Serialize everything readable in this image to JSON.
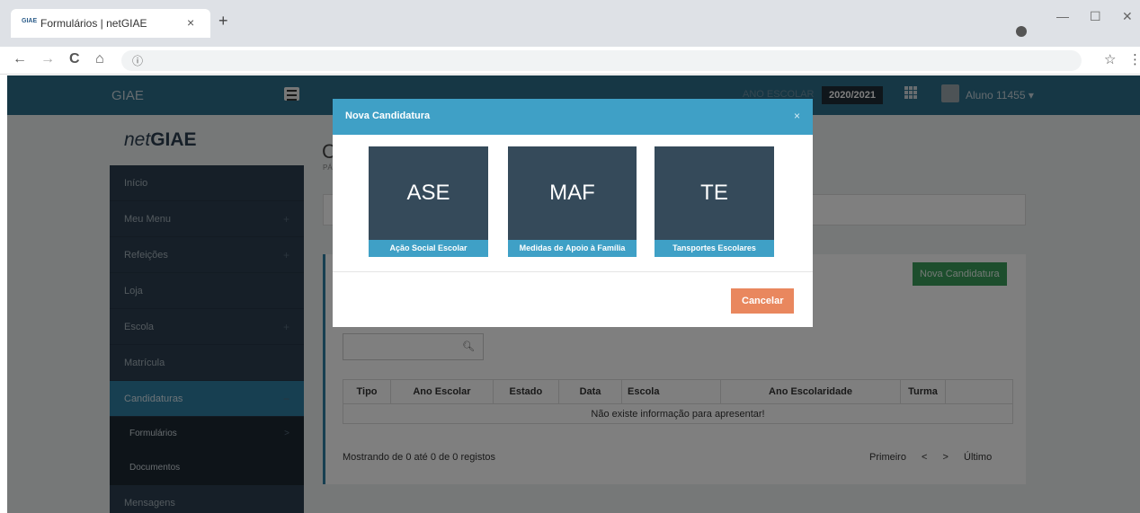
{
  "browser": {
    "tab_title": "Formulários | netGIAE",
    "favicon_text": "GIAE",
    "tab_close": "×",
    "new_tab": "+",
    "minimize": "—",
    "maximize": "☐",
    "close": "✕",
    "back": "←",
    "forward": "→",
    "reload": "C",
    "home": "⌂",
    "info": "ⓘ",
    "star": "☆",
    "menu": "⋮"
  },
  "topbar": {
    "brand": "GIAE",
    "school_year_label": "ANO ESCOLAR",
    "school_year": "2020/2021",
    "user": "Aluno 11455 ▾"
  },
  "sidebar": {
    "logo_prefix": "net",
    "logo_main": "GIAE",
    "items": [
      {
        "label": "Início",
        "suffix": ""
      },
      {
        "label": "Meu Menu",
        "suffix": "+"
      },
      {
        "label": "Refeições",
        "suffix": "+"
      },
      {
        "label": "Loja",
        "suffix": ""
      },
      {
        "label": "Escola",
        "suffix": "+"
      },
      {
        "label": "Matrícula",
        "suffix": ""
      },
      {
        "label": "Candidaturas",
        "suffix": "−"
      }
    ],
    "subitems": [
      {
        "label": "Formulários",
        "suffix": ">"
      },
      {
        "label": "Documentos",
        "suffix": ""
      }
    ],
    "after": [
      {
        "label": "Mensagens"
      }
    ]
  },
  "content": {
    "title": "C",
    "subtitle": "PÁ",
    "nova_button": "Nova Candidatura",
    "table_headers": [
      "Tipo",
      "Ano Escolar",
      "Estado",
      "Data",
      "Escola",
      "Ano Escolaridade",
      "Turma",
      ""
    ],
    "empty_message": "Não existe informação para apresentar!",
    "records_text": "Mostrando de 0 até 0 de 0 registos",
    "pager": [
      "Primeiro",
      "<",
      ">",
      "Último"
    ]
  },
  "modal": {
    "title": "Nova Candidatura",
    "close": "×",
    "tiles": [
      {
        "abbr": "ASE",
        "label": "Ação Social Escolar"
      },
      {
        "abbr": "MAF",
        "label": "Medidas de Apoio à Família"
      },
      {
        "abbr": "TE",
        "label": "Tansportes Escolares"
      }
    ],
    "cancel": "Cancelar"
  },
  "colors": {
    "topbar": "#2c6f8a",
    "sidebar": "#2c3e50",
    "accent": "#3fa0c6",
    "success": "#3b9d5b",
    "cancel": "#e9875e"
  }
}
